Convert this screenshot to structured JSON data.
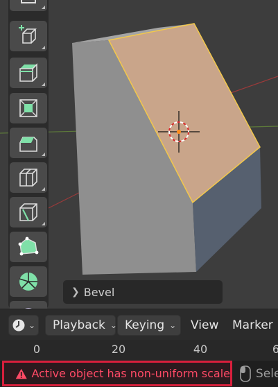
{
  "viewport": {
    "last_operator_panel": {
      "label": "Bevel"
    }
  },
  "toolbar": {
    "tools": [
      "transform-tool-icon",
      "add-cube-icon",
      "extrude-region-icon",
      "inset-faces-icon",
      "bevel-icon",
      "loop-cut-icon",
      "knife-icon",
      "poly-build-icon",
      "spin-icon",
      "smooth-icon"
    ]
  },
  "timeline_header": {
    "editor_type_icon": "clock-icon",
    "menus": {
      "playback": "Playback",
      "keying": "Keying",
      "view": "View",
      "marker": "Marker"
    }
  },
  "timeline_ruler": {
    "ticks": [
      "0",
      "20",
      "40",
      "6"
    ]
  },
  "status_bar": {
    "warning": "Active object has non-uniform scale",
    "select_label": "Sele"
  },
  "colors": {
    "selected_face": "#c9a58a",
    "active_edge": "#f2c84b",
    "warning_text": "#ff4a66",
    "warning_border": "#d81f3c"
  }
}
